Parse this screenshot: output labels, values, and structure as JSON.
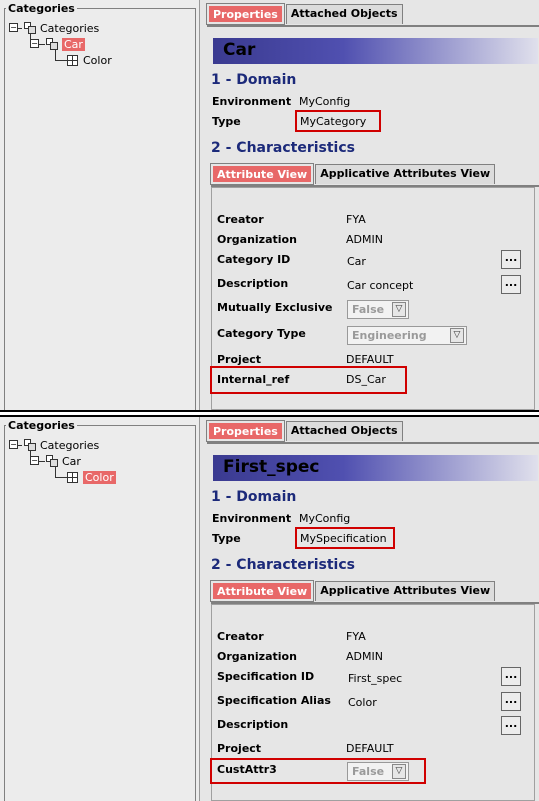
{
  "panels": [
    {
      "tree": {
        "title": "Categories",
        "root_label": "Categories",
        "child_label": "Car",
        "leaf_label": "Color",
        "selected": "child"
      },
      "tabs": {
        "properties": "Properties",
        "attached": "Attached Objects"
      },
      "object_title": "Car",
      "domain": {
        "heading": "1 - Domain",
        "env_label": "Environment",
        "env_value": "MyConfig",
        "type_label": "Type",
        "type_value": "MyCategory"
      },
      "characteristics": {
        "heading": "2 - Characteristics",
        "tab_attribute": "Attribute View",
        "tab_applicative": "Applicative Attributes View",
        "rows": [
          {
            "label": "Creator",
            "value": "FYA"
          },
          {
            "label": "Organization",
            "value": "ADMIN"
          },
          {
            "label": "Category ID",
            "value": "Car",
            "button": "..."
          },
          {
            "label": "Description",
            "value": "Car concept",
            "button": "..."
          },
          {
            "label": "Mutually Exclusive",
            "combo": "False"
          },
          {
            "label": "Category Type",
            "combo": "Engineering"
          },
          {
            "label": "Project",
            "value": "DEFAULT"
          },
          {
            "label": "Internal_ref",
            "value": "DS_Car"
          }
        ]
      }
    },
    {
      "tree": {
        "title": "Categories",
        "root_label": "Categories",
        "child_label": "Car",
        "leaf_label": "Color",
        "selected": "leaf"
      },
      "tabs": {
        "properties": "Properties",
        "attached": "Attached Objects"
      },
      "object_title": "First_spec",
      "domain": {
        "heading": "1 - Domain",
        "env_label": "Environment",
        "env_value": "MyConfig",
        "type_label": "Type",
        "type_value": "MySpecification"
      },
      "characteristics": {
        "heading": "2 - Characteristics",
        "tab_attribute": "Attribute View",
        "tab_applicative": "Applicative Attributes View",
        "rows": [
          {
            "label": "Creator",
            "value": "FYA"
          },
          {
            "label": "Organization",
            "value": "ADMIN"
          },
          {
            "label": "Specification ID",
            "value": "First_spec",
            "button": "..."
          },
          {
            "label": "Specification Alias",
            "value": "Color",
            "button": "..."
          },
          {
            "label": "Description",
            "value": "",
            "button": "..."
          },
          {
            "label": "Project",
            "value": "DEFAULT"
          },
          {
            "label": "CustAttr3",
            "combo": "False"
          }
        ]
      }
    }
  ],
  "icons": {
    "button_dots": "ellipsis-icon",
    "combo_arrow": "triangle-down-icon"
  },
  "colors": {
    "selection": "#e86868",
    "highlight_box": "#d00000",
    "heading": "#1c2a7a",
    "title_bar": "#3a3a90"
  }
}
